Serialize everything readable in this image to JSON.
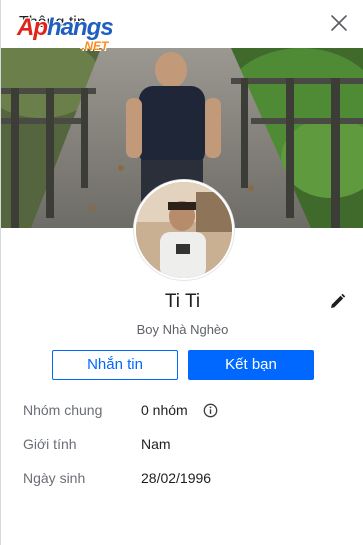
{
  "header": {
    "title": "Thông tin",
    "close_icon": "close-icon"
  },
  "watermark": {
    "main_part1": "Ap",
    "main_part2": "hangs",
    "sub": ".NET"
  },
  "profile": {
    "name": "Ti Ti",
    "bio": "Boy Nhà Nghèo",
    "edit_icon": "pencil-icon"
  },
  "actions": {
    "message_label": "Nhắn tin",
    "add_friend_label": "Kết bạn"
  },
  "info": [
    {
      "label": "Nhóm chung",
      "value": "0 nhóm",
      "icon": "info-circle-icon"
    },
    {
      "label": "Giới tính",
      "value": "Nam"
    },
    {
      "label": "Ngày sinh",
      "value": "28/02/1996"
    }
  ],
  "colors": {
    "accent": "#0068ff",
    "text_primary": "#1c1e21",
    "text_secondary": "#6a6f76"
  }
}
